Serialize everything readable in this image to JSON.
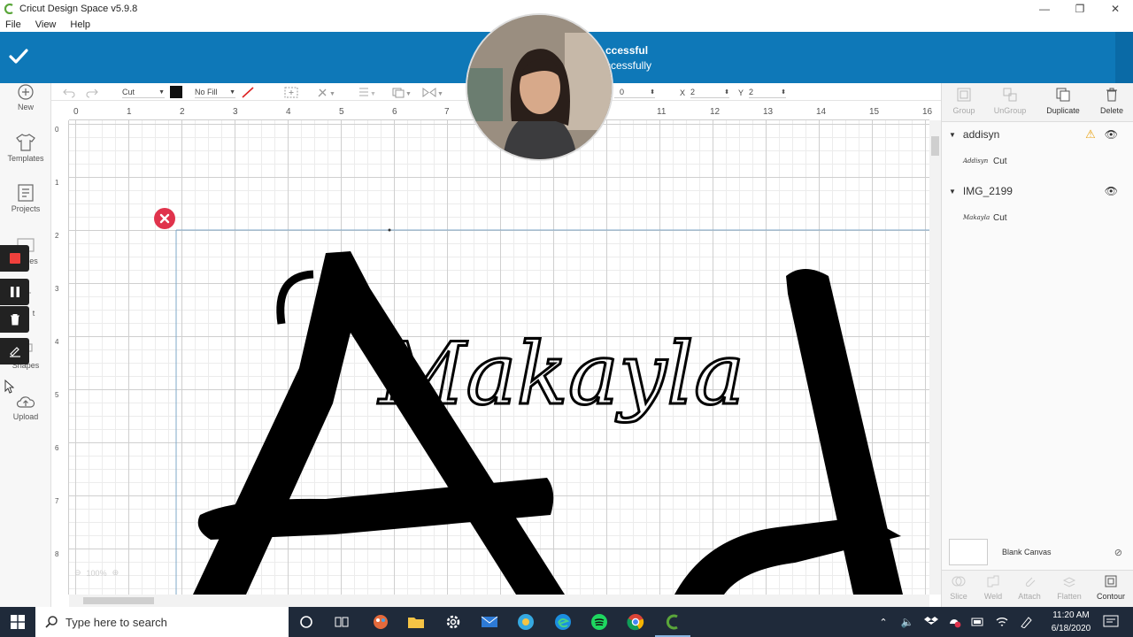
{
  "window": {
    "title": "Cricut Design Space  v5.9.8"
  },
  "menu": {
    "file": "File",
    "view": "View",
    "help": "Help"
  },
  "banner": {
    "line1": "ccessful",
    "line2": "ccessfully"
  },
  "sidebar": {
    "items": [
      {
        "label": "New"
      },
      {
        "label": "Templates"
      },
      {
        "label": "Projects"
      },
      {
        "label": "Shapes"
      },
      {
        "label": "Upload"
      }
    ],
    "partial_labels": [
      "es",
      "t"
    ]
  },
  "toolbar": {
    "linetype": "Cut",
    "fill": "No Fill",
    "rotate_value": "0",
    "x_label": "X",
    "x_value": "2",
    "y_label": "Y",
    "y_value": "2"
  },
  "ruler": {
    "top": [
      "0",
      "1",
      "2",
      "3",
      "4",
      "5",
      "6",
      "7",
      "",
      "",
      "11",
      "12",
      "13",
      "14",
      "15",
      "16"
    ],
    "left": [
      "0",
      "1",
      "2",
      "3",
      "4",
      "5",
      "6",
      "7",
      "8"
    ]
  },
  "canvas": {
    "script_text": "Makayla",
    "zoom": "100%"
  },
  "panel": {
    "tools": [
      {
        "label": "Group"
      },
      {
        "label": "UnGroup"
      },
      {
        "label": "Duplicate"
      },
      {
        "label": "Delete"
      }
    ],
    "layers": [
      {
        "name": "addisyn",
        "thumb": "Addisyn",
        "type": "Cut",
        "warning": true
      },
      {
        "name": "IMG_2199",
        "thumb": "Makayla",
        "type": "Cut",
        "warning": false
      }
    ],
    "blank_canvas": "Blank Canvas",
    "bottom_tools": [
      {
        "label": "Slice"
      },
      {
        "label": "Weld"
      },
      {
        "label": "Attach"
      },
      {
        "label": "Flatten"
      },
      {
        "label": "Contour"
      }
    ]
  },
  "taskbar": {
    "search_placeholder": "Type here to search",
    "time": "11:20 AM",
    "date": "6/18/2020"
  },
  "colors": {
    "banner": "#0e78b8",
    "taskbar": "#1f2a3a",
    "accent_green": "#5aa63a",
    "error_red": "#e0334c"
  }
}
